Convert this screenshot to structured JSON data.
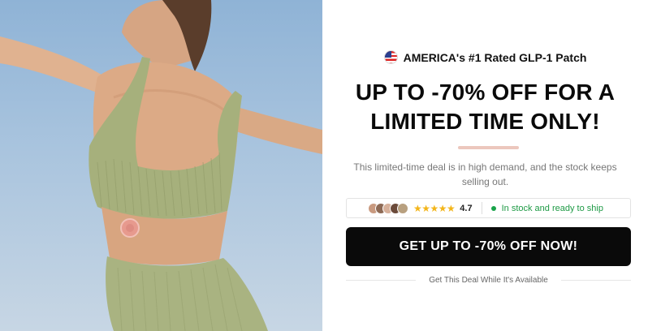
{
  "hero": {
    "image_alt": "Woman in sage green ribbed sports top with patch on lower back",
    "icons": [
      "patch-icon"
    ]
  },
  "promo": {
    "tagline": "AMERICA's #1 Rated GLP-1 Patch",
    "flag_icon": "us-flag-icon",
    "headline": "UP TO -70% OFF FOR A LIMITED TIME ONLY!",
    "subtext": "This limited-time deal is in high demand, and the stock keeps selling out.",
    "stock_bar": {
      "stars": "★★★★★",
      "rating": "4.7",
      "stock_text": "In stock and ready to ship",
      "avatar_colors": [
        "#c99a80",
        "#8e6a55",
        "#d7b19b",
        "#6b4a3a",
        "#b8a07f"
      ]
    },
    "cta_label": "GET UP TO -70% OFF NOW!",
    "footnote": "Get This Deal While It's Available"
  },
  "colors": {
    "cta_bg": "#0a0a0a",
    "accent_pill": "#ecc7bd",
    "stock_green": "#1e9a45",
    "star": "#f3b519"
  }
}
